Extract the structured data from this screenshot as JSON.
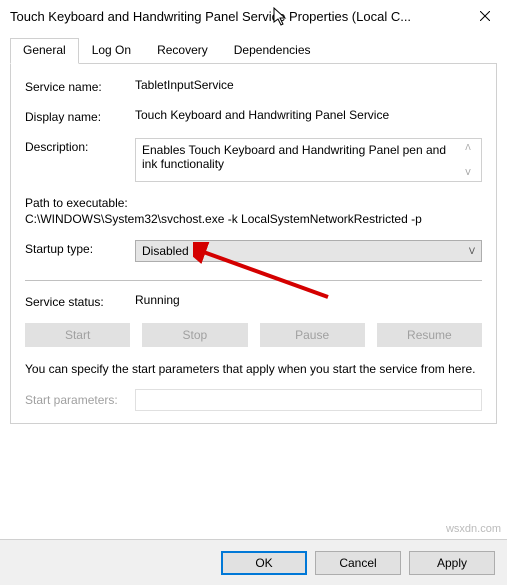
{
  "window": {
    "title": "Touch Keyboard and Handwriting Panel Service Properties (Local C..."
  },
  "tabs": {
    "general": "General",
    "logon": "Log On",
    "recovery": "Recovery",
    "dependencies": "Dependencies"
  },
  "general": {
    "service_name_label": "Service name:",
    "service_name": "TabletInputService",
    "display_name_label": "Display name:",
    "display_name": "Touch Keyboard and Handwriting Panel Service",
    "description_label": "Description:",
    "description": "Enables Touch Keyboard and Handwriting Panel pen and ink functionality",
    "path_label": "Path to executable:",
    "path_value": "C:\\WINDOWS\\System32\\svchost.exe -k LocalSystemNetworkRestricted -p",
    "startup_label": "Startup type:",
    "startup_value": "Disabled",
    "status_label": "Service status:",
    "status_value": "Running",
    "start": "Start",
    "stop": "Stop",
    "pause": "Pause",
    "resume": "Resume",
    "note": "You can specify the start parameters that apply when you start the service from here.",
    "param_label": "Start parameters:"
  },
  "footer": {
    "ok": "OK",
    "cancel": "Cancel",
    "apply": "Apply"
  },
  "watermark": "wsxdn.com"
}
